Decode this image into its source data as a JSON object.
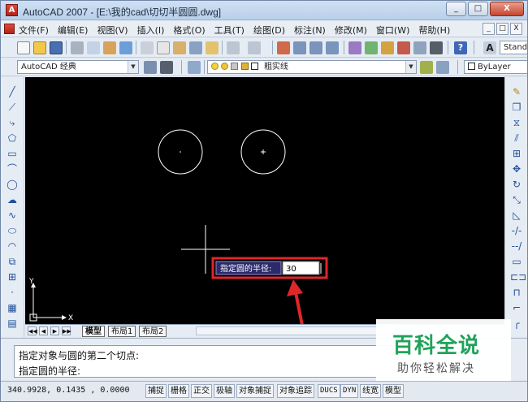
{
  "window": {
    "title": "AutoCAD 2007 - [E:\\我的cad\\切切半圆圆.dwg]",
    "app_icon_glyph": "A",
    "buttons": [
      "_",
      "□",
      "X"
    ]
  },
  "menu": {
    "items": [
      "文件(F)",
      "编辑(E)",
      "视图(V)",
      "插入(I)",
      "格式(O)",
      "工具(T)",
      "绘图(D)",
      "标注(N)",
      "修改(M)",
      "窗口(W)",
      "帮助(H)"
    ],
    "mdi_buttons": [
      "_",
      "□",
      "X"
    ]
  },
  "toolbar": {
    "textstyle_combo": "Standa",
    "workspace_combo": "AutoCAD 经典",
    "layer_combo": "粗实线",
    "color_combo": "ByLayer"
  },
  "canvas": {
    "background": "#000000",
    "ucs_x_label": "X",
    "ucs_y_label": "Y",
    "prompt_label": "指定圆的半径:",
    "prompt_value": "30",
    "highlight_color": "#e0262a"
  },
  "tabs": {
    "nav": [
      "◀◀",
      "◀",
      "▶",
      "▶▶"
    ],
    "items": [
      "模型",
      "布局1",
      "布局2"
    ]
  },
  "command": {
    "lines": [
      "指定对象与圆的第二个切点:",
      "指定圆的半径:"
    ]
  },
  "status": {
    "coords": "340.9928, 0.1435 , 0.0000",
    "buttons": [
      "捕捉",
      "栅格",
      "正交",
      "极轴",
      "对象捕捉",
      "对象追踪",
      "DUCS",
      "DYN",
      "线宽",
      "模型"
    ]
  },
  "watermark": {
    "title": "百科全说",
    "subtitle": "助你轻松解决"
  }
}
